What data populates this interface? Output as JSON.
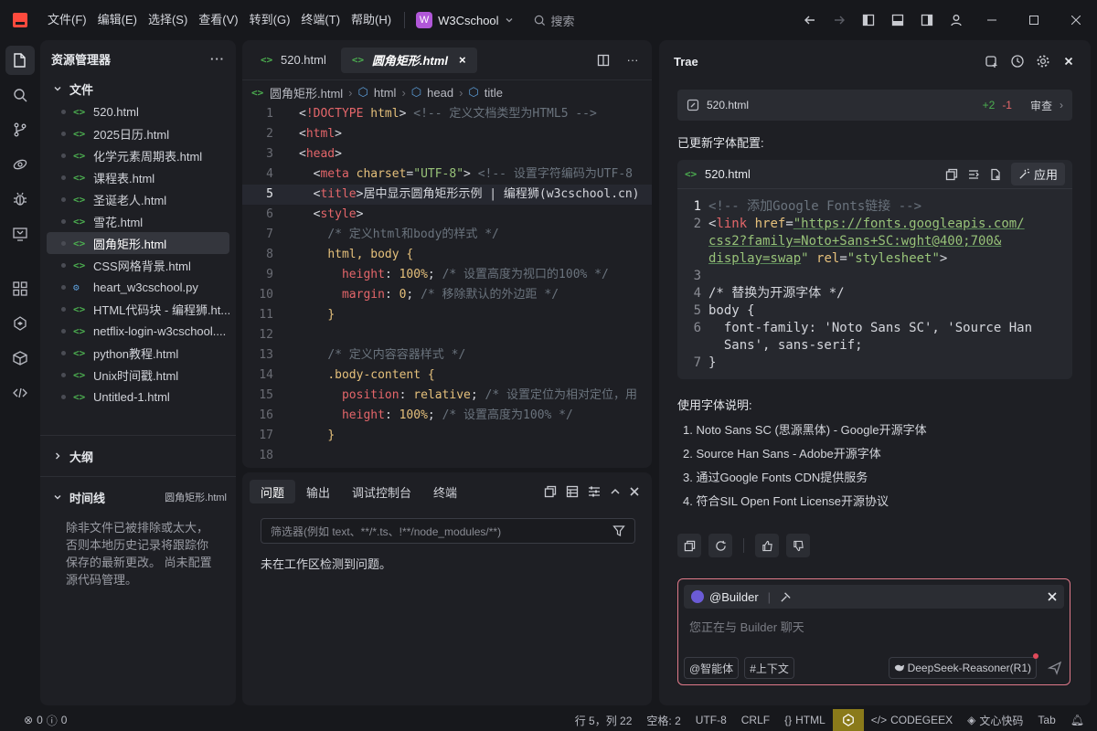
{
  "titlebar": {
    "menus": [
      "文件(F)",
      "编辑(E)",
      "选择(S)",
      "查看(V)",
      "转到(G)",
      "终端(T)",
      "帮助(H)"
    ],
    "workspace_badge": "W",
    "workspace_name": "W3Cschool",
    "search_label": "搜索"
  },
  "explorer": {
    "title": "资源管理器",
    "section_files": "文件",
    "files": [
      {
        "name": "520.html",
        "icon": "html"
      },
      {
        "name": "2025日历.html",
        "icon": "html"
      },
      {
        "name": "化学元素周期表.html",
        "icon": "html"
      },
      {
        "name": "课程表.html",
        "icon": "html"
      },
      {
        "name": "圣诞老人.html",
        "icon": "html"
      },
      {
        "name": "雪花.html",
        "icon": "html"
      },
      {
        "name": "圆角矩形.html",
        "icon": "html"
      },
      {
        "name": "CSS网格背景.html",
        "icon": "html"
      },
      {
        "name": "heart_w3cschool.py",
        "icon": "python"
      },
      {
        "name": "HTML代码块 - 编程狮.ht...",
        "icon": "html"
      },
      {
        "name": "netflix-login-w3cschool....",
        "icon": "html"
      },
      {
        "name": "python教程.html",
        "icon": "html"
      },
      {
        "name": "Unix时间戳.html",
        "icon": "html"
      },
      {
        "name": "Untitled-1.html",
        "icon": "html"
      }
    ],
    "active_file_index": 6,
    "section_outline": "大纲",
    "section_timeline": "时间线",
    "timeline_file": "圆角矩形.html",
    "timeline_note": "除非文件已被排除或太大，否则本地历史记录将跟踪你保存的最新更改。 尚未配置源代码管理。"
  },
  "editor": {
    "tabs": [
      {
        "label": "520.html"
      },
      {
        "label": "圆角矩形.html",
        "close": "×"
      }
    ],
    "breadcrumb": [
      "圆角矩形.html",
      "html",
      "head",
      "title"
    ],
    "current_line": 5
  },
  "panel": {
    "tabs": [
      "问题",
      "输出",
      "调试控制台",
      "终端"
    ],
    "filter_placeholder": "筛选器(例如 text、**/*.ts、!**/node_modules/**)",
    "message": "未在工作区检测到问题。"
  },
  "chat": {
    "title": "Trae",
    "file_change": {
      "name": "520.html",
      "added": "+2",
      "removed": "-1",
      "review": "审查"
    },
    "updated_text": "已更新字体配置:",
    "code_card": {
      "filename": "520.html",
      "apply": "应用"
    },
    "fonts_heading": "使用字体说明:",
    "fonts": [
      "1. Noto Sans SC (思源黑体) - Google开源字体",
      "2. Source Han Sans - Adobe开源字体",
      "3. 通过Google Fonts CDN提供服务",
      "4. 符合SIL Open Font License开源协议"
    ],
    "input": {
      "agent": "@Builder",
      "placeholder": "您正在与 Builder 聊天",
      "agent_btn": "@智能体",
      "context_btn": "#上下文",
      "model": "DeepSeek-Reasoner(R1)"
    }
  },
  "statusbar": {
    "errors": "0",
    "warnings": "0",
    "position": "行 5，列 22",
    "spaces": "空格: 2",
    "encoding": "UTF-8",
    "eol": "CRLF",
    "language": "HTML",
    "codegeex": "CODEGEEX",
    "wenxin": "文心快码",
    "tab": "Tab"
  }
}
